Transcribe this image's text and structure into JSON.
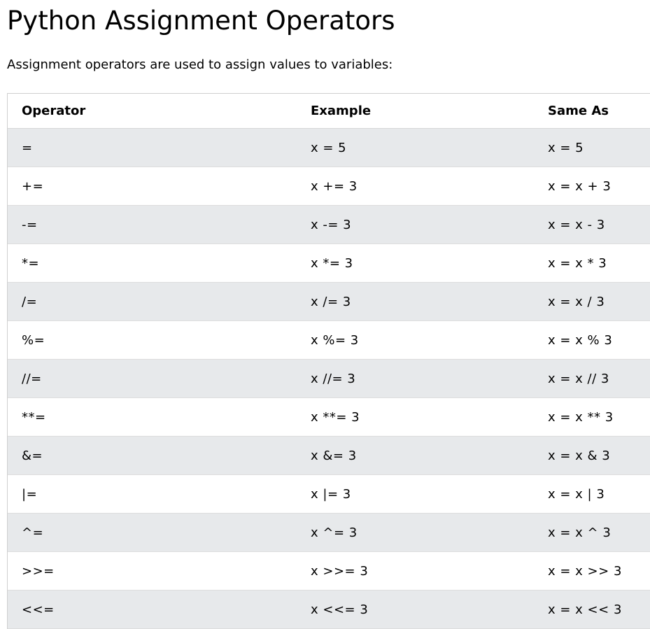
{
  "page": {
    "title": "Python Assignment Operators",
    "intro": "Assignment operators are used to assign values to variables:"
  },
  "table": {
    "headers": [
      "Operator",
      "Example",
      "Same As"
    ],
    "rows": [
      [
        "=",
        "x = 5",
        "x = 5"
      ],
      [
        "+=",
        "x += 3",
        "x = x + 3"
      ],
      [
        "-=",
        "x -= 3",
        "x = x - 3"
      ],
      [
        "*=",
        "x *= 3",
        "x = x * 3"
      ],
      [
        "/=",
        "x /= 3",
        "x = x / 3"
      ],
      [
        "%=",
        "x %= 3",
        "x = x % 3"
      ],
      [
        "//=",
        "x //= 3",
        "x = x // 3"
      ],
      [
        "**=",
        "x **= 3",
        "x = x ** 3"
      ],
      [
        "&=",
        "x &= 3",
        "x = x & 3"
      ],
      [
        "|=",
        "x |= 3",
        "x = x | 3"
      ],
      [
        "^=",
        "x ^= 3",
        "x = x ^ 3"
      ],
      [
        ">>=",
        "x >>= 3",
        "x = x >> 3"
      ],
      [
        "<<=",
        "x <<= 3",
        "x = x << 3"
      ]
    ]
  },
  "colors": {
    "stripe": "#e7e9eb",
    "border": "#dddddd"
  }
}
